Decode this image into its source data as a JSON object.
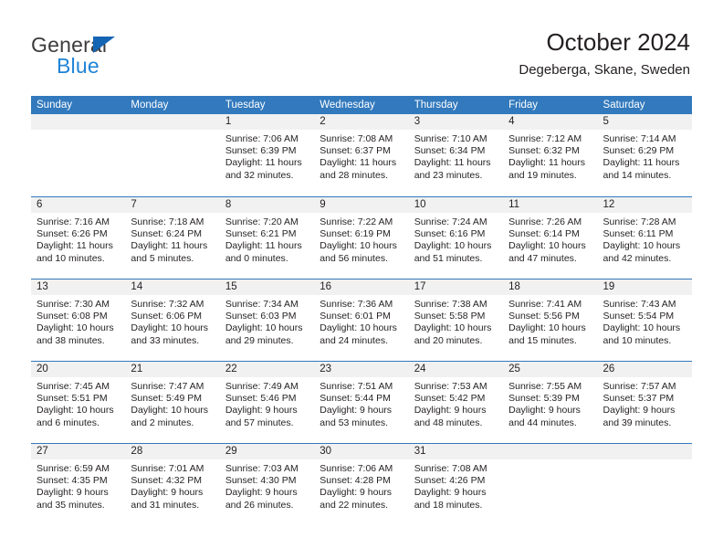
{
  "brand": {
    "name_top": "General",
    "name_bottom": "Blue",
    "accent_color": "#1f84d6",
    "triangle_color": "#1565b5"
  },
  "header": {
    "title": "October 2024",
    "subtitle": "Degeberga, Skane, Sweden"
  },
  "calendar": {
    "header_bg": "#3279bd",
    "day_band_bg": "#f1f1f1",
    "weekdays": [
      "Sunday",
      "Monday",
      "Tuesday",
      "Wednesday",
      "Thursday",
      "Friday",
      "Saturday"
    ],
    "weeks": [
      [
        {
          "date": "",
          "lines": []
        },
        {
          "date": "",
          "lines": []
        },
        {
          "date": "1",
          "lines": [
            "Sunrise: 7:06 AM",
            "Sunset: 6:39 PM",
            "Daylight: 11 hours",
            "and 32 minutes."
          ]
        },
        {
          "date": "2",
          "lines": [
            "Sunrise: 7:08 AM",
            "Sunset: 6:37 PM",
            "Daylight: 11 hours",
            "and 28 minutes."
          ]
        },
        {
          "date": "3",
          "lines": [
            "Sunrise: 7:10 AM",
            "Sunset: 6:34 PM",
            "Daylight: 11 hours",
            "and 23 minutes."
          ]
        },
        {
          "date": "4",
          "lines": [
            "Sunrise: 7:12 AM",
            "Sunset: 6:32 PM",
            "Daylight: 11 hours",
            "and 19 minutes."
          ]
        },
        {
          "date": "5",
          "lines": [
            "Sunrise: 7:14 AM",
            "Sunset: 6:29 PM",
            "Daylight: 11 hours",
            "and 14 minutes."
          ]
        }
      ],
      [
        {
          "date": "6",
          "lines": [
            "Sunrise: 7:16 AM",
            "Sunset: 6:26 PM",
            "Daylight: 11 hours",
            "and 10 minutes."
          ]
        },
        {
          "date": "7",
          "lines": [
            "Sunrise: 7:18 AM",
            "Sunset: 6:24 PM",
            "Daylight: 11 hours",
            "and 5 minutes."
          ]
        },
        {
          "date": "8",
          "lines": [
            "Sunrise: 7:20 AM",
            "Sunset: 6:21 PM",
            "Daylight: 11 hours",
            "and 0 minutes."
          ]
        },
        {
          "date": "9",
          "lines": [
            "Sunrise: 7:22 AM",
            "Sunset: 6:19 PM",
            "Daylight: 10 hours",
            "and 56 minutes."
          ]
        },
        {
          "date": "10",
          "lines": [
            "Sunrise: 7:24 AM",
            "Sunset: 6:16 PM",
            "Daylight: 10 hours",
            "and 51 minutes."
          ]
        },
        {
          "date": "11",
          "lines": [
            "Sunrise: 7:26 AM",
            "Sunset: 6:14 PM",
            "Daylight: 10 hours",
            "and 47 minutes."
          ]
        },
        {
          "date": "12",
          "lines": [
            "Sunrise: 7:28 AM",
            "Sunset: 6:11 PM",
            "Daylight: 10 hours",
            "and 42 minutes."
          ]
        }
      ],
      [
        {
          "date": "13",
          "lines": [
            "Sunrise: 7:30 AM",
            "Sunset: 6:08 PM",
            "Daylight: 10 hours",
            "and 38 minutes."
          ]
        },
        {
          "date": "14",
          "lines": [
            "Sunrise: 7:32 AM",
            "Sunset: 6:06 PM",
            "Daylight: 10 hours",
            "and 33 minutes."
          ]
        },
        {
          "date": "15",
          "lines": [
            "Sunrise: 7:34 AM",
            "Sunset: 6:03 PM",
            "Daylight: 10 hours",
            "and 29 minutes."
          ]
        },
        {
          "date": "16",
          "lines": [
            "Sunrise: 7:36 AM",
            "Sunset: 6:01 PM",
            "Daylight: 10 hours",
            "and 24 minutes."
          ]
        },
        {
          "date": "17",
          "lines": [
            "Sunrise: 7:38 AM",
            "Sunset: 5:58 PM",
            "Daylight: 10 hours",
            "and 20 minutes."
          ]
        },
        {
          "date": "18",
          "lines": [
            "Sunrise: 7:41 AM",
            "Sunset: 5:56 PM",
            "Daylight: 10 hours",
            "and 15 minutes."
          ]
        },
        {
          "date": "19",
          "lines": [
            "Sunrise: 7:43 AM",
            "Sunset: 5:54 PM",
            "Daylight: 10 hours",
            "and 10 minutes."
          ]
        }
      ],
      [
        {
          "date": "20",
          "lines": [
            "Sunrise: 7:45 AM",
            "Sunset: 5:51 PM",
            "Daylight: 10 hours",
            "and 6 minutes."
          ]
        },
        {
          "date": "21",
          "lines": [
            "Sunrise: 7:47 AM",
            "Sunset: 5:49 PM",
            "Daylight: 10 hours",
            "and 2 minutes."
          ]
        },
        {
          "date": "22",
          "lines": [
            "Sunrise: 7:49 AM",
            "Sunset: 5:46 PM",
            "Daylight: 9 hours",
            "and 57 minutes."
          ]
        },
        {
          "date": "23",
          "lines": [
            "Sunrise: 7:51 AM",
            "Sunset: 5:44 PM",
            "Daylight: 9 hours",
            "and 53 minutes."
          ]
        },
        {
          "date": "24",
          "lines": [
            "Sunrise: 7:53 AM",
            "Sunset: 5:42 PM",
            "Daylight: 9 hours",
            "and 48 minutes."
          ]
        },
        {
          "date": "25",
          "lines": [
            "Sunrise: 7:55 AM",
            "Sunset: 5:39 PM",
            "Daylight: 9 hours",
            "and 44 minutes."
          ]
        },
        {
          "date": "26",
          "lines": [
            "Sunrise: 7:57 AM",
            "Sunset: 5:37 PM",
            "Daylight: 9 hours",
            "and 39 minutes."
          ]
        }
      ],
      [
        {
          "date": "27",
          "lines": [
            "Sunrise: 6:59 AM",
            "Sunset: 4:35 PM",
            "Daylight: 9 hours",
            "and 35 minutes."
          ]
        },
        {
          "date": "28",
          "lines": [
            "Sunrise: 7:01 AM",
            "Sunset: 4:32 PM",
            "Daylight: 9 hours",
            "and 31 minutes."
          ]
        },
        {
          "date": "29",
          "lines": [
            "Sunrise: 7:03 AM",
            "Sunset: 4:30 PM",
            "Daylight: 9 hours",
            "and 26 minutes."
          ]
        },
        {
          "date": "30",
          "lines": [
            "Sunrise: 7:06 AM",
            "Sunset: 4:28 PM",
            "Daylight: 9 hours",
            "and 22 minutes."
          ]
        },
        {
          "date": "31",
          "lines": [
            "Sunrise: 7:08 AM",
            "Sunset: 4:26 PM",
            "Daylight: 9 hours",
            "and 18 minutes."
          ]
        },
        {
          "date": "",
          "lines": []
        },
        {
          "date": "",
          "lines": []
        }
      ]
    ]
  }
}
